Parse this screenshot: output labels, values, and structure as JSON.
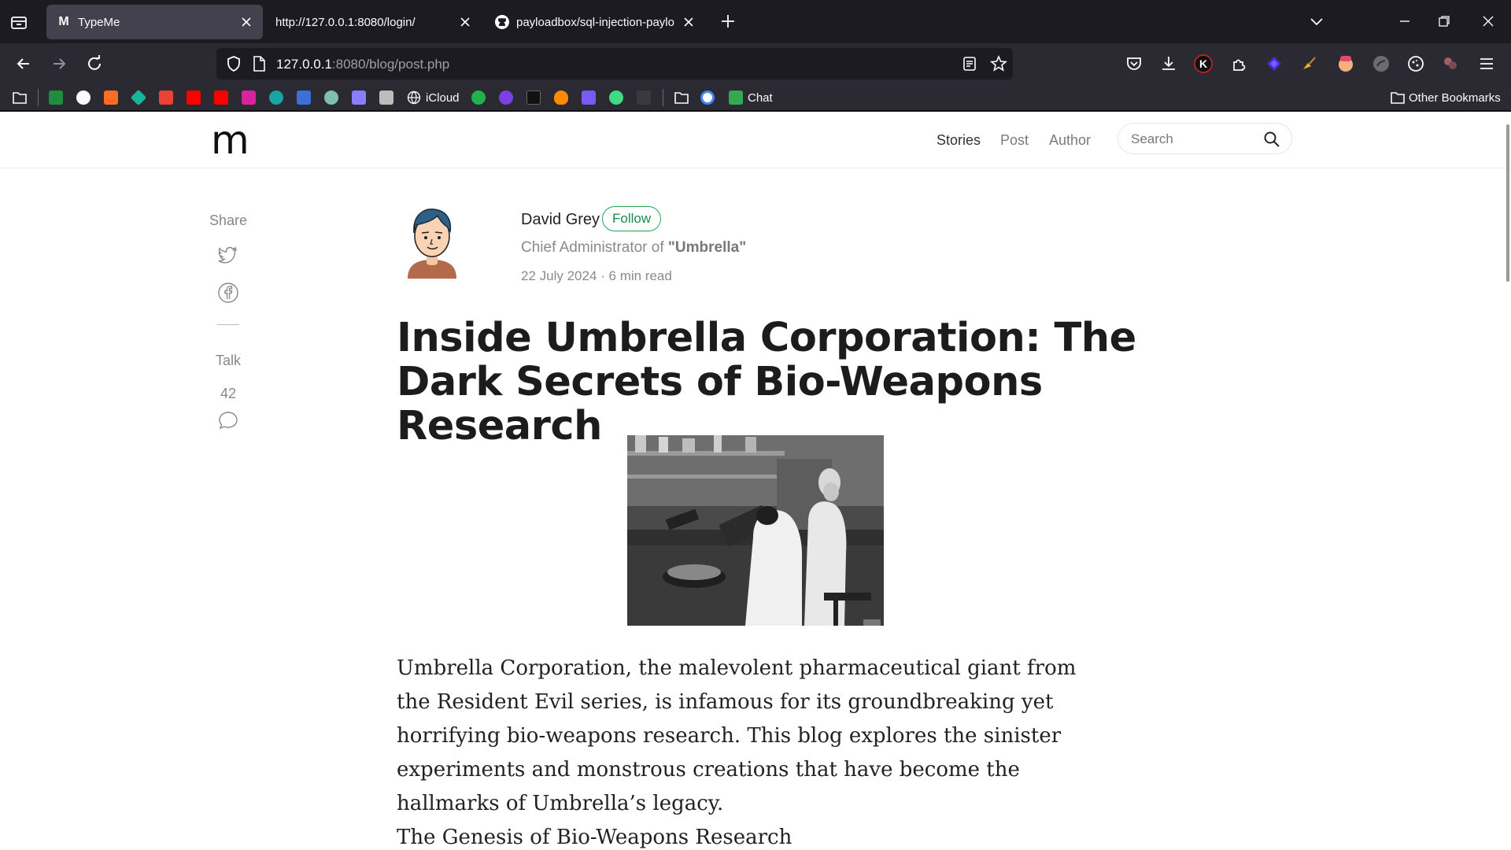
{
  "tabs": [
    {
      "label": "TypeMe",
      "favicon": "M",
      "active": true
    },
    {
      "label": "http://127.0.0.1:8080/login/",
      "active": false
    },
    {
      "label": "payloadbox/sql-injection-paylo",
      "favicon": "github-icon",
      "active": false
    }
  ],
  "address": {
    "host": "127.0.0.1",
    "rest": ":8080/blog/post.php"
  },
  "bookmarks": {
    "icloud": "iCloud",
    "chat": "Chat",
    "other": "Other Bookmarks"
  },
  "site": {
    "logo": "m",
    "nav": [
      "Stories",
      "Post",
      "Author"
    ],
    "search_placeholder": "Search"
  },
  "sidebar": {
    "share": "Share",
    "talk": "Talk",
    "comment_count": "42"
  },
  "author": {
    "name": "David Grey",
    "follow": "Follow",
    "role_prefix": "Chief Administrator of",
    "role_org": "\"Umbrella\"",
    "meta": "22 July 2024 · 6 min read"
  },
  "post": {
    "title": "Inside Umbrella Corporation: The Dark Secrets of Bio-Weapons Research",
    "body": "Umbrella Corporation, the malevolent pharmaceutical giant from the Resident Evil series, is infamous for its groundbreaking yet horrifying bio-weapons research. This blog explores the sinister experiments and monstrous creations that have become the hallmarks of Umbrella’s legacy.",
    "subheading": "The Genesis of Bio-Weapons Research"
  },
  "colors": {
    "follow": "#21a65b",
    "chrome_dark": "#1c1b22",
    "chrome": "#2b2a33"
  }
}
